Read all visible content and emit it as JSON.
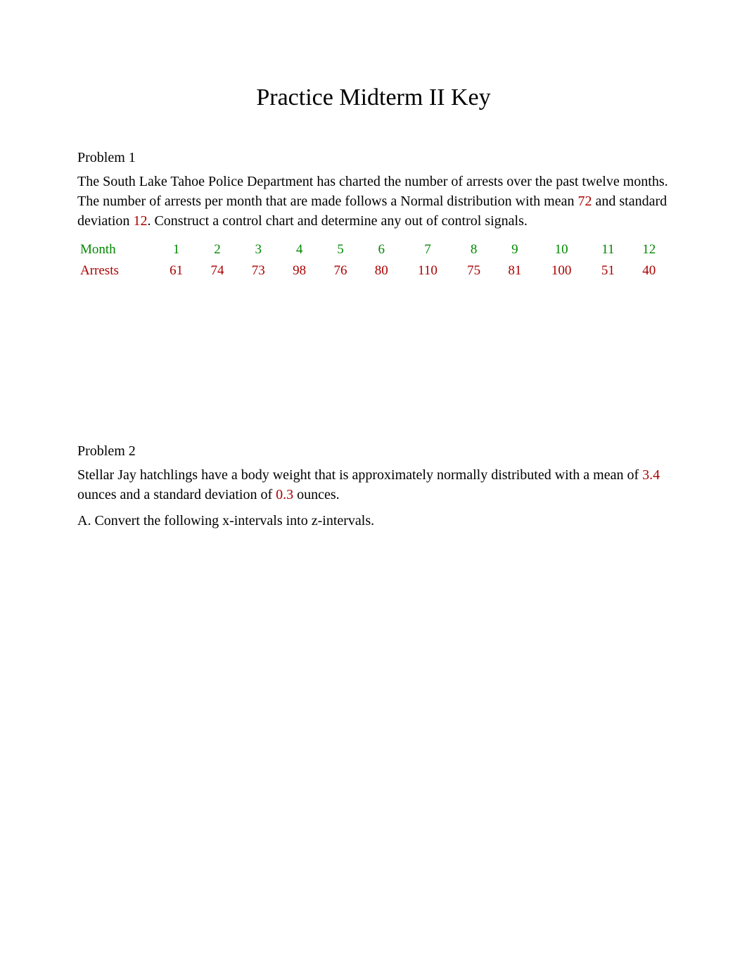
{
  "title": "Practice Midterm II Key",
  "problem1": {
    "heading": "Problem 1",
    "text_before_mean": "The South Lake Tahoe Police Department has charted the number of arrests over the past twelve months. The number of arrests per month that are made follows a Normal distribution with mean ",
    "mean": "72",
    "text_mid": " and standard deviation ",
    "sd": "12",
    "text_after_sd": ". Construct a control chart and determine any out of control signals.",
    "table": {
      "month_label": "Month",
      "arrests_label": "Arrests",
      "months": [
        "1",
        "2",
        "3",
        "4",
        "5",
        "6",
        "7",
        "8",
        "9",
        "10",
        "11",
        "12"
      ],
      "arrests": [
        "61",
        "74",
        "73",
        "98",
        "76",
        "80",
        "110",
        "75",
        "81",
        "100",
        "51",
        "40"
      ]
    }
  },
  "problem2": {
    "heading": "Problem 2",
    "text_before_mean": "Stellar Jay hatchlings have a body weight that is approximately normally distributed with a mean of ",
    "mean": "3.4",
    "text_mid": " ounces and a standard deviation of ",
    "sd": "0.3",
    "text_after_sd": " ounces.",
    "partA": "A. Convert the following x-intervals into z-intervals."
  }
}
